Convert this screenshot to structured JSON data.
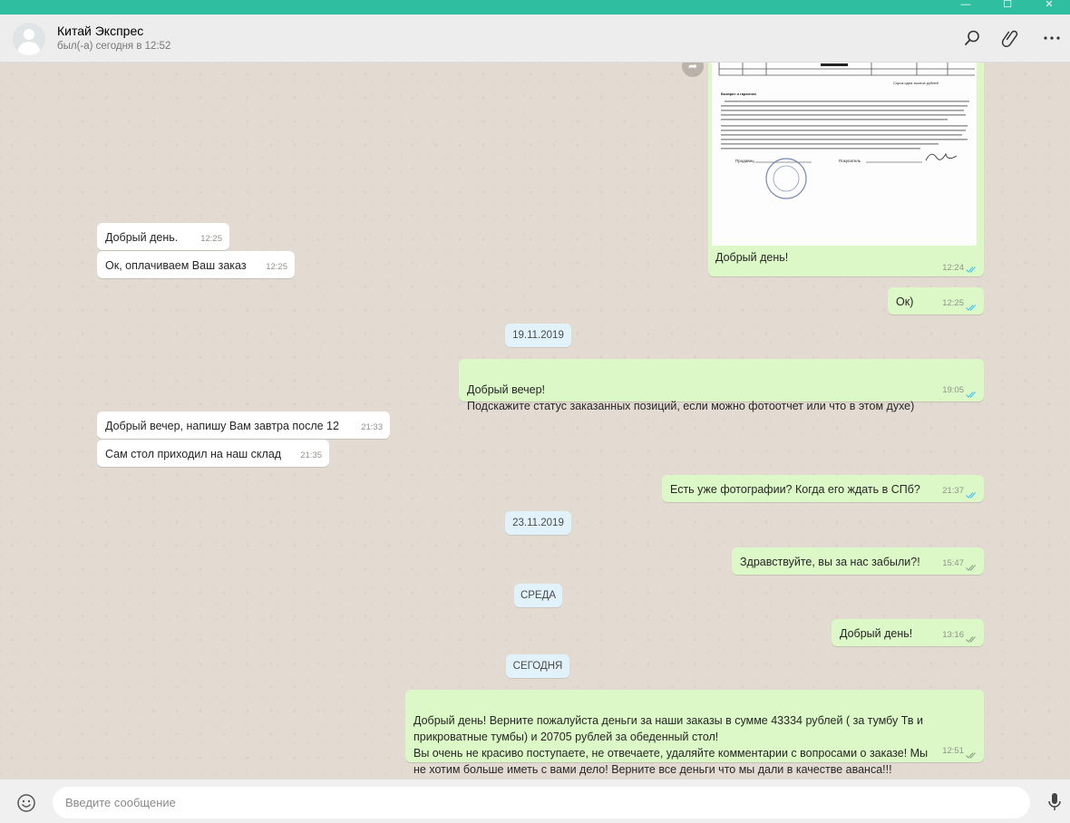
{
  "window": {
    "controls": [
      "—",
      "☐",
      "✕"
    ],
    "accent": "#2fbfa0"
  },
  "contact": {
    "name": "Китай Экспрес",
    "status": "был(-а) сегодня в 12:52"
  },
  "header_icons": [
    "search-icon",
    "attach-icon",
    "menu-icon"
  ],
  "image_message": {
    "doc_lines": [
      "Сорок одна тысяча рублей",
      "Возврат и гарантии",
      "Продавец",
      "Покупатель"
    ],
    "caption": "Добрый день!",
    "time": "12:24",
    "status": "read"
  },
  "messages": [
    {
      "id": "m1",
      "dir": "in",
      "text": "Добрый день.",
      "time": "12:25"
    },
    {
      "id": "m2",
      "dir": "in",
      "text": "Ок, оплачиваем Ваш заказ",
      "time": "12:25"
    },
    {
      "id": "m3",
      "dir": "out",
      "text": "Ок)",
      "time": "12:25",
      "status": "read"
    },
    {
      "id": "d1",
      "type": "date",
      "text": "19.11.2019"
    },
    {
      "id": "m4",
      "dir": "out",
      "text": "Добрый вечер!\nПодскажите статус заказанных позиций, если можно фотоотчет или что в этом духе)",
      "time": "19:05",
      "status": "read"
    },
    {
      "id": "m5",
      "dir": "in",
      "text": "Добрый вечер, напишу Вам завтра после 12",
      "time": "21:33"
    },
    {
      "id": "m6",
      "dir": "in",
      "text": "Сам стол приходил на наш склад",
      "time": "21:35"
    },
    {
      "id": "m7",
      "dir": "out",
      "text": "Есть уже фотографии? Когда его ждать в СПб?",
      "time": "21:37",
      "status": "read"
    },
    {
      "id": "d2",
      "type": "date",
      "text": "23.11.2019"
    },
    {
      "id": "m8",
      "dir": "out",
      "text": "Здравствуйте, вы за нас забыли?!",
      "time": "15:47",
      "status": "delivered"
    },
    {
      "id": "d3",
      "type": "date",
      "text": "СРЕДА"
    },
    {
      "id": "m9",
      "dir": "out",
      "text": "Добрый день!",
      "time": "13:16",
      "status": "delivered"
    },
    {
      "id": "d4",
      "type": "date",
      "text": "СЕГОДНЯ"
    },
    {
      "id": "m10",
      "dir": "out",
      "text": "Добрый день! Верните пожалуйста деньги за наши заказы в сумме 43334 рублей ( за тумбу Тв и прикроватные тумбы) и 20705 рублей за обеденный стол!\nВы очень не красиво поступаете, не отвечаете, удаляйте комментарии с вопросами о заказе! Мы не хотим больше иметь с вами дело! Верните все деньги что мы дали в качестве аванса!!!",
      "time": "12:51",
      "status": "delivered"
    }
  ],
  "composer": {
    "placeholder": "Введите сообщение"
  },
  "colors": {
    "incoming": "#ffffff",
    "outgoing": "#dcf8c6",
    "date_pill": "#e1f2fb",
    "read_ticks": "#4fc3f7",
    "delivered_ticks": "#92a58c"
  }
}
